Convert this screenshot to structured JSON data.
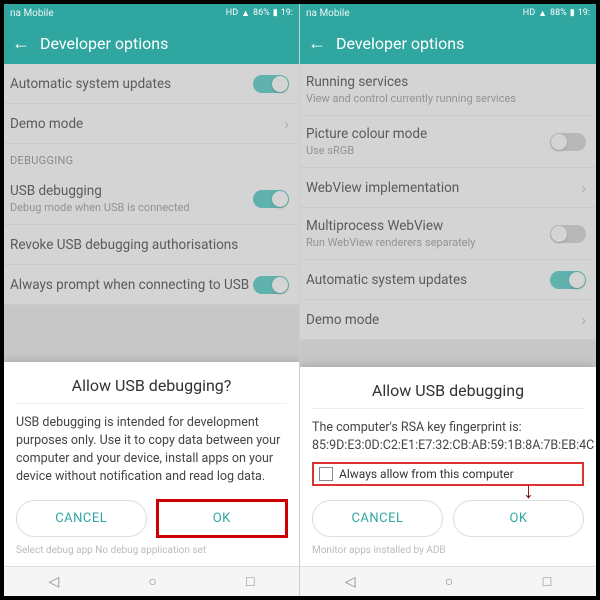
{
  "status": {
    "carrier": "na Mobile",
    "signal": "86%",
    "signal2": "88%",
    "time": "19:"
  },
  "appbar": {
    "title": "Developer options"
  },
  "left": {
    "items": {
      "auto_updates": "Automatic system updates",
      "demo": "Demo mode",
      "section_debug": "DEBUGGING",
      "usb_debug": "USB debugging",
      "usb_debug_sub": "Debug mode when USB is connected",
      "revoke": "Revoke USB debugging authorisations",
      "always_prompt": "Always prompt when connecting to USB"
    },
    "dialog": {
      "title": "Allow USB debugging?",
      "body": "USB debugging is intended for development purposes only. Use it to copy data between your computer and your device, install apps on your device without notification and read log data.",
      "cancel": "CANCEL",
      "ok": "OK"
    },
    "peek": "Select debug app     No debug application set"
  },
  "right": {
    "items": {
      "running": "Running services",
      "running_sub": "View and control currently running services",
      "picture": "Picture colour mode",
      "picture_sub": "Use sRGB",
      "webview": "WebView implementation",
      "multiproc": "Multiprocess WebView",
      "multiproc_sub": "Run WebView renderers separately",
      "auto_updates": "Automatic system updates",
      "demo": "Demo mode"
    },
    "dialog": {
      "title": "Allow USB debugging",
      "fp_label": "The computer's RSA key fingerprint is:",
      "fp": "85:9D:E3:0D:C2:E1:E7:32:CB:AB:59:1B:8A:7B:EB:4C",
      "checkbox": "Always allow from this computer",
      "cancel": "CANCEL",
      "ok": "OK"
    },
    "peek": "Monitor apps installed by ADB"
  }
}
